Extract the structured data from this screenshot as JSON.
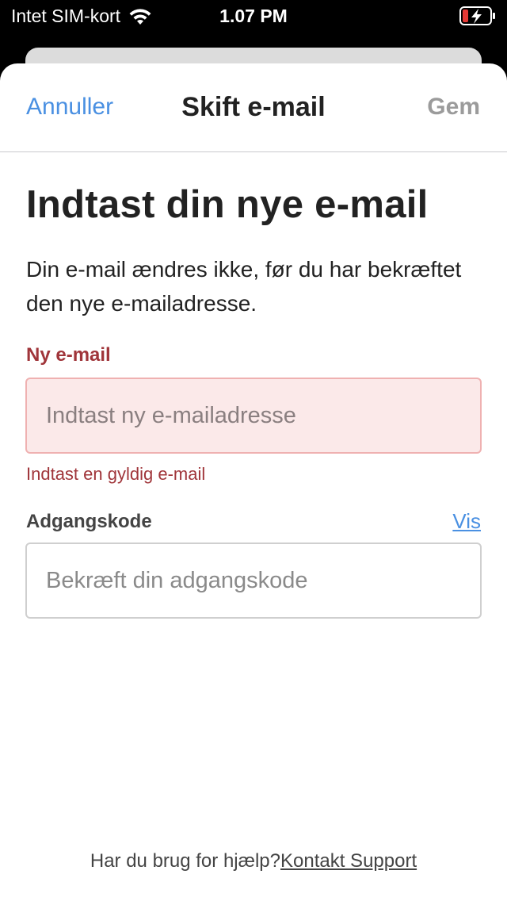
{
  "status_bar": {
    "carrier": "Intet SIM-kort",
    "time": "1.07 PM",
    "icons": [
      "wifi-icon",
      "battery-charging-icon"
    ],
    "battery_low_color": "#e53935"
  },
  "nav": {
    "cancel_label": "Annuller",
    "title": "Skift e-mail",
    "save_label": "Gem"
  },
  "main": {
    "heading": "Indtast din nye e-mail",
    "description": "Din e-mail ændres ikke, før du har bekræftet den nye e-mailadresse."
  },
  "form": {
    "email": {
      "label": "Ny e-mail",
      "placeholder": "Indtast ny e-mailadresse",
      "value": "",
      "error": "Indtast en gyldig e-mail"
    },
    "password": {
      "label": "Adgangskode",
      "show_label": "Vis",
      "placeholder": "Bekræft din adgangskode",
      "value": ""
    }
  },
  "footer": {
    "help_text": "Har du brug for hjælp?",
    "support_link": "Kontakt Support"
  },
  "colors": {
    "accent_blue": "#4a90e2",
    "error_red": "#a0353a",
    "error_bg": "#fbe9e9",
    "disabled_gray": "#9b9b9b"
  }
}
